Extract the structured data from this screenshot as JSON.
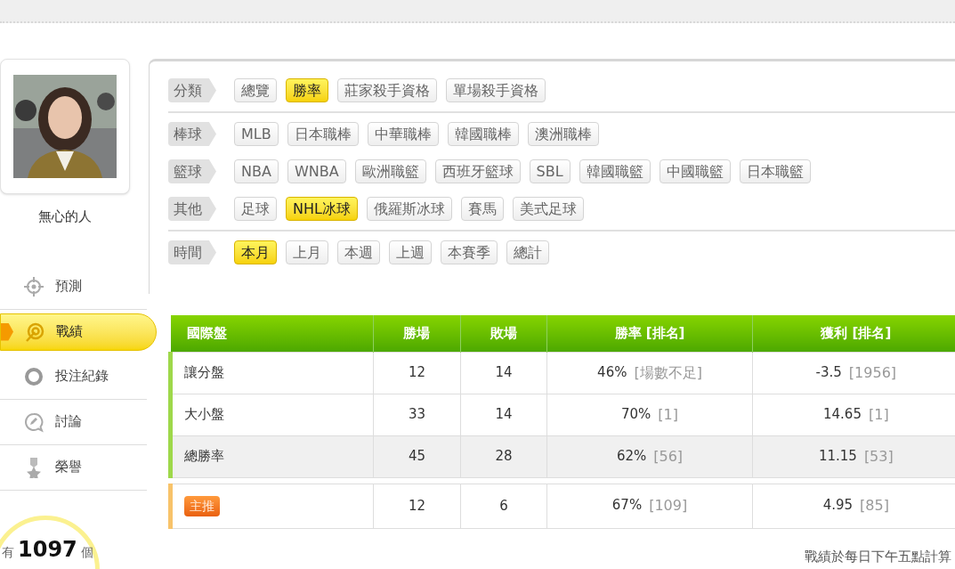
{
  "profile": {
    "name": "無心的人"
  },
  "nav": [
    {
      "label": "預測",
      "selected": false
    },
    {
      "label": "戰績",
      "selected": true
    },
    {
      "label": "投注紀錄",
      "selected": false
    },
    {
      "label": "討論",
      "selected": false
    },
    {
      "label": "榮譽",
      "selected": false
    }
  ],
  "counter": {
    "prefix": "有",
    "count": "1097",
    "suffix": "個"
  },
  "filter_sections": [
    [
      {
        "label": "分類",
        "options": [
          {
            "text": "總覽",
            "selected": false
          },
          {
            "text": "勝率",
            "selected": true
          },
          {
            "text": "莊家殺手資格",
            "selected": false
          },
          {
            "text": "單場殺手資格",
            "selected": false
          }
        ]
      }
    ],
    [
      {
        "label": "棒球",
        "options": [
          {
            "text": "MLB",
            "selected": false
          },
          {
            "text": "日本職棒",
            "selected": false
          },
          {
            "text": "中華職棒",
            "selected": false
          },
          {
            "text": "韓國職棒",
            "selected": false
          },
          {
            "text": "澳洲職棒",
            "selected": false
          }
        ]
      },
      {
        "label": "籃球",
        "options": [
          {
            "text": "NBA",
            "selected": false
          },
          {
            "text": "WNBA",
            "selected": false
          },
          {
            "text": "歐洲職籃",
            "selected": false
          },
          {
            "text": "西班牙籃球",
            "selected": false
          },
          {
            "text": "SBL",
            "selected": false
          },
          {
            "text": "韓國職籃",
            "selected": false
          },
          {
            "text": "中國職籃",
            "selected": false
          },
          {
            "text": "日本職籃",
            "selected": false
          }
        ]
      },
      {
        "label": "其他",
        "options": [
          {
            "text": "足球",
            "selected": false
          },
          {
            "text": "NHL冰球",
            "selected": true
          },
          {
            "text": "俄羅斯冰球",
            "selected": false
          },
          {
            "text": "賽馬",
            "selected": false
          },
          {
            "text": "美式足球",
            "selected": false
          }
        ]
      }
    ],
    [
      {
        "label": "時間",
        "options": [
          {
            "text": "本月",
            "selected": true
          },
          {
            "text": "上月",
            "selected": false
          },
          {
            "text": "本週",
            "selected": false
          },
          {
            "text": "上週",
            "selected": false
          },
          {
            "text": "本賽季",
            "selected": false
          },
          {
            "text": "總計",
            "selected": false
          }
        ]
      }
    ]
  ],
  "table": {
    "columns": [
      "國際盤",
      "勝場",
      "敗場",
      "勝率 [排名]",
      "獲利 [排名]"
    ],
    "rows": [
      {
        "kind": "plain",
        "label": "讓分盤",
        "wins": "12",
        "losses": "14",
        "rate": "46%",
        "rate_rank": "[場數不足]",
        "profit": "-3.5",
        "profit_rank": "[1956]"
      },
      {
        "kind": "plain",
        "label": "大小盤",
        "wins": "33",
        "losses": "14",
        "rate": "70%",
        "rate_rank": "[1]",
        "profit": "14.65",
        "profit_rank": "[1]"
      },
      {
        "kind": "total",
        "label": "總勝率",
        "wins": "45",
        "losses": "28",
        "rate": "62%",
        "rate_rank": "[56]",
        "profit": "11.15",
        "profit_rank": "[53]"
      },
      {
        "kind": "featured",
        "label": "主推",
        "wins": "12",
        "losses": "6",
        "rate": "67%",
        "rate_rank": "[109]",
        "profit": "4.95",
        "profit_rank": "[85]"
      }
    ]
  },
  "footnote": "戰績於每日下午五點計算"
}
